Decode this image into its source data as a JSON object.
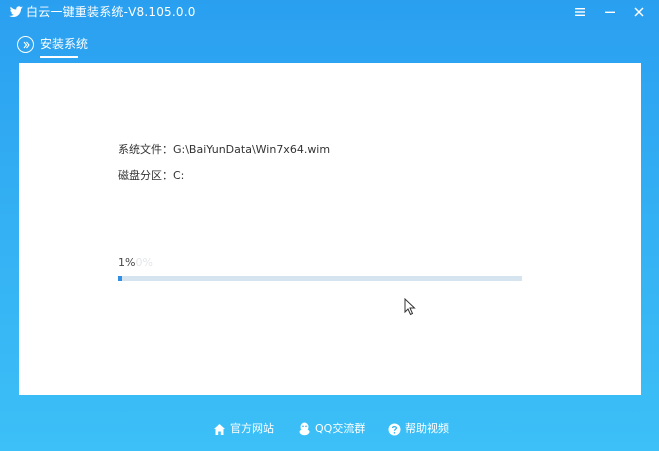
{
  "window": {
    "title": "白云一键重装系统-V8.105.0.0",
    "controls": [
      "menu-icon",
      "minimize-icon",
      "close-icon"
    ]
  },
  "tabs": [
    {
      "label": "安装系统",
      "active": true,
      "icon": "chevron-right-circle-icon"
    }
  ],
  "install": {
    "file_label": "系统文件：G:\\BaiYunData\\Win7x64.wim",
    "disk_label": "磁盘分区：C:",
    "progress_text": "1%",
    "progress_ghost": "0%",
    "progress_fraction": 0.01
  },
  "footer": {
    "links": [
      {
        "label": "官方网站",
        "icon": "home-icon"
      },
      {
        "label": "QQ交流群",
        "icon": "qq-penguin-icon"
      },
      {
        "label": "帮助视频",
        "icon": "help-icon"
      }
    ]
  },
  "colors": {
    "header_blue": "#2a9ff0",
    "progress_fill": "#2f8fe3",
    "progress_track": "#d6e4f0"
  }
}
